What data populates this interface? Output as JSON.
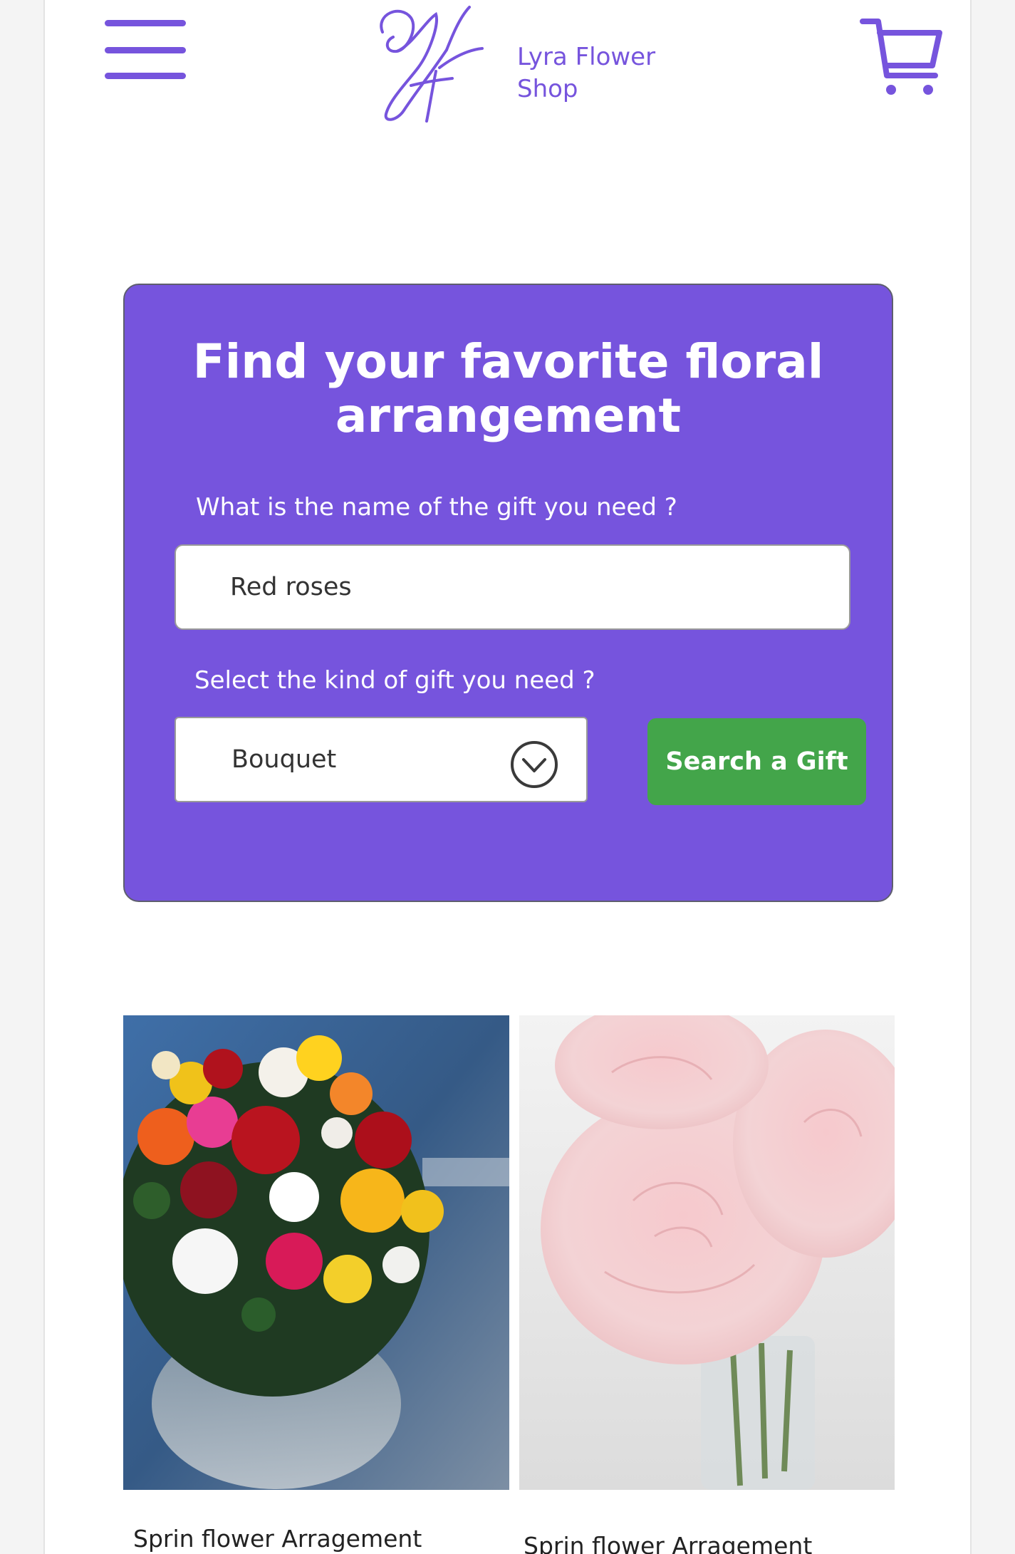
{
  "header": {
    "brand_line1": "Lyra Flower",
    "brand_line2": "Shop",
    "menu_icon": "hamburger-menu-icon",
    "cart_icon": "shopping-cart-icon",
    "accent_color": "#7654dd"
  },
  "search": {
    "title_line1": "Find your favorite floral",
    "title_line2": "arrangement",
    "name_label": "What is the name of the gift you need ?",
    "name_value": "Red roses",
    "kind_label": "Select the kind of gift you need ?",
    "kind_selected": "Bouquet",
    "button_label": "Search a Gift",
    "card_color": "#7654dd",
    "button_color": "#43a54a"
  },
  "products": [
    {
      "name": "Sprin flower Arragement"
    },
    {
      "name": "Sprin flower Arragement"
    }
  ]
}
